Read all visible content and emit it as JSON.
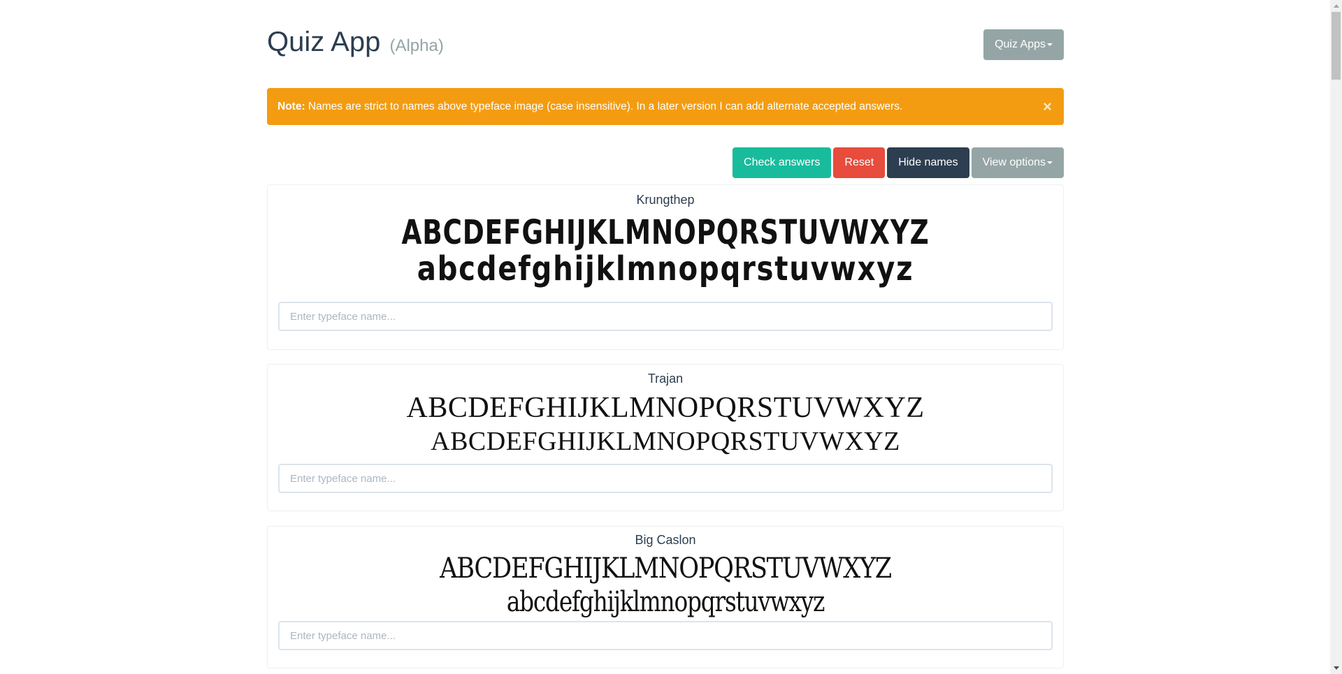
{
  "header": {
    "title": "Quiz App",
    "subtitle": "(Alpha)",
    "quiz_apps_label": "Quiz Apps"
  },
  "alert": {
    "label": "Note:",
    "message": " Names are strict to names above typeface image (case insensitive). In a later version I can add alternate accepted answers.",
    "close_symbol": "×"
  },
  "toolbar": {
    "check_label": "Check answers",
    "reset_label": "Reset",
    "hide_label": "Hide names",
    "view_label": "View options"
  },
  "cards": [
    {
      "name": "Krungthep",
      "line1": "ABCDEFGHIJKLMNOPQRSTUVWXYZ",
      "line2": "abcdefghijklmnopqrstuvwxyz",
      "input_placeholder": "Enter typeface name...",
      "input_value": ""
    },
    {
      "name": "Trajan",
      "line1": "ABCDEFGHIJKLMNOPQRSTUVWXYZ",
      "line2": "ABCDEFGHIJKLMNOPQRSTUVWXYZ",
      "input_placeholder": "Enter typeface name...",
      "input_value": ""
    },
    {
      "name": "Big Caslon",
      "line1": "ABCDEFGHIJKLMNOPQRSTUVWXYZ",
      "line2": "abcdefghijklmnopqrstuvwxyz",
      "input_placeholder": "Enter typeface name...",
      "input_value": ""
    }
  ],
  "colors": {
    "primary": "#2c3e50",
    "success": "#18bc9c",
    "danger": "#e74c3c",
    "warning": "#f39c12",
    "secondary": "#95a5a6"
  }
}
